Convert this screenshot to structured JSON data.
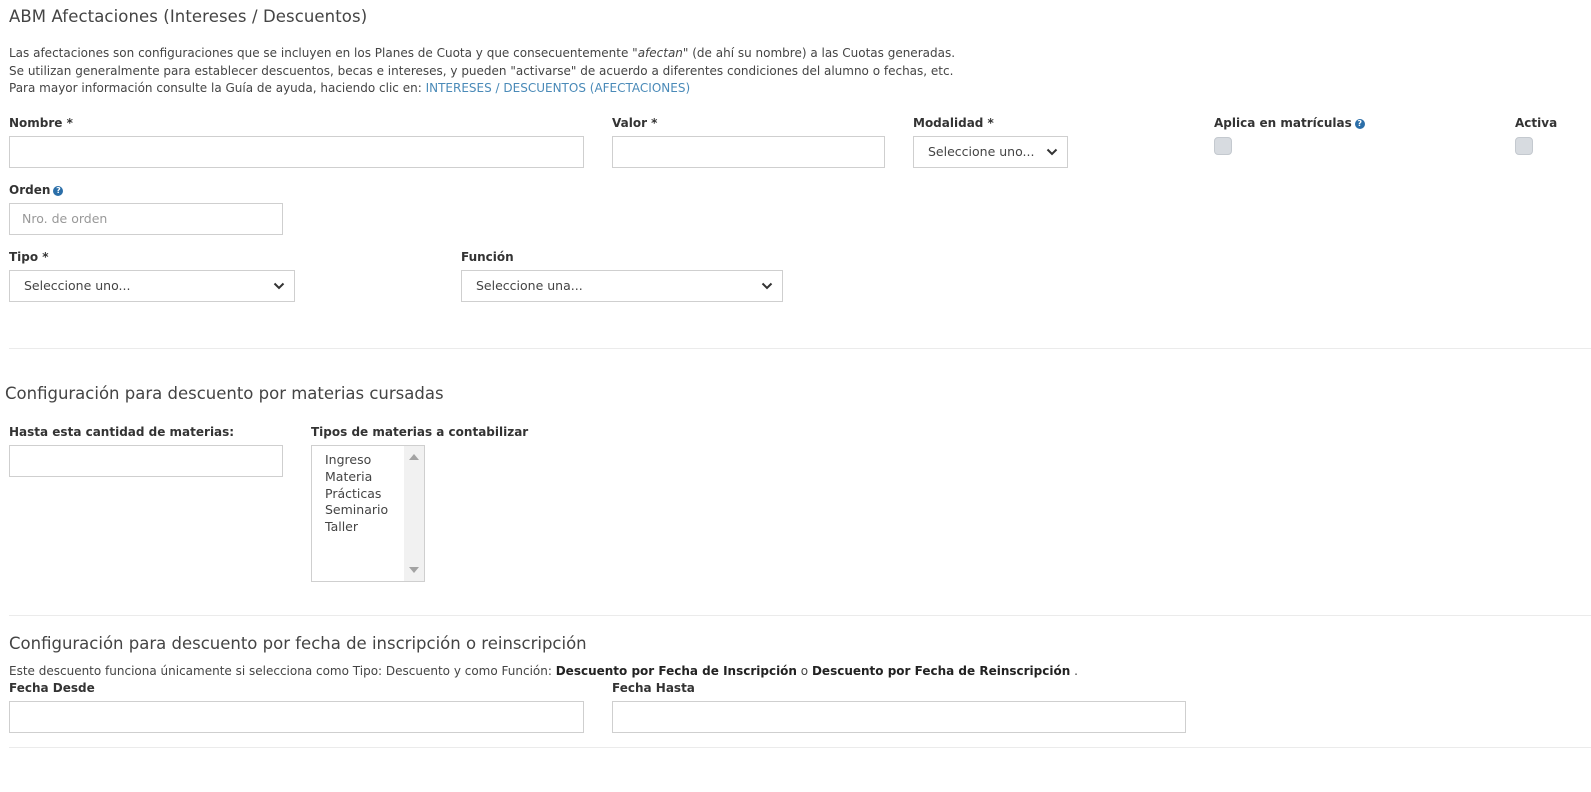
{
  "page_title": "ABM Afectaciones (Intereses / Descuentos)",
  "intro": {
    "line1_pre": "Las afectaciones son configuraciones que se incluyen en los Planes de Cuota y que consecuentemente ",
    "line1_em": "\"afectan\"",
    "line1_post": " (de ahí su nombre) a las Cuotas generadas.",
    "line2": "Se utilizan generalmente para establecer descuentos, becas e intereses, y pueden \"activarse\" de acuerdo a diferentes condiciones del alumno o fechas, etc.",
    "line3_pre": "Para mayor información consulte la Guía de ayuda, haciendo clic en: ",
    "line3_link": "INTERESES / DESCUENTOS (AFECTACIONES)"
  },
  "form": {
    "nombre_label": "Nombre *",
    "nombre_value": "",
    "valor_label": "Valor *",
    "valor_value": "",
    "modalidad_label": "Modalidad *",
    "modalidad_selected": "Seleccione uno...",
    "aplica_label": "Aplica en matrículas",
    "aplica_checked": false,
    "activa_label": "Activa",
    "activa_checked": false,
    "orden_label": "Orden",
    "orden_placeholder": "Nro. de orden",
    "tipo_label": "Tipo *",
    "tipo_selected": "Seleccione uno...",
    "funcion_label": "Función",
    "funcion_selected": "Seleccione una..."
  },
  "materias_section": {
    "title": "Configuración para descuento por materias cursadas",
    "cantidad_label": "Hasta esta cantidad de materias:",
    "cantidad_value": "",
    "tipos_label": "Tipos de materias a contabilizar",
    "tipos_options": [
      "Ingreso",
      "Materia",
      "Prácticas",
      "Seminario",
      "Taller"
    ]
  },
  "fecha_section": {
    "title": "Configuración para descuento por fecha de inscripción o reinscripción",
    "note_pre": "Este descuento funciona únicamente si selecciona como Tipo: Descuento y como Función: ",
    "note_b1": "Descuento por Fecha de Inscripción",
    "note_mid": " o ",
    "note_b2": "Descuento por Fecha de Reinscripción",
    "note_post": " .",
    "desde_label": "Fecha Desde",
    "desde_value": "",
    "hasta_label": "Fecha Hasta",
    "hasta_value": ""
  },
  "colors": {
    "link": "#4a8ab8",
    "help_icon": "#2b6ea8",
    "checkbox": "#d7dbe0",
    "border": "#cfcfcf"
  }
}
